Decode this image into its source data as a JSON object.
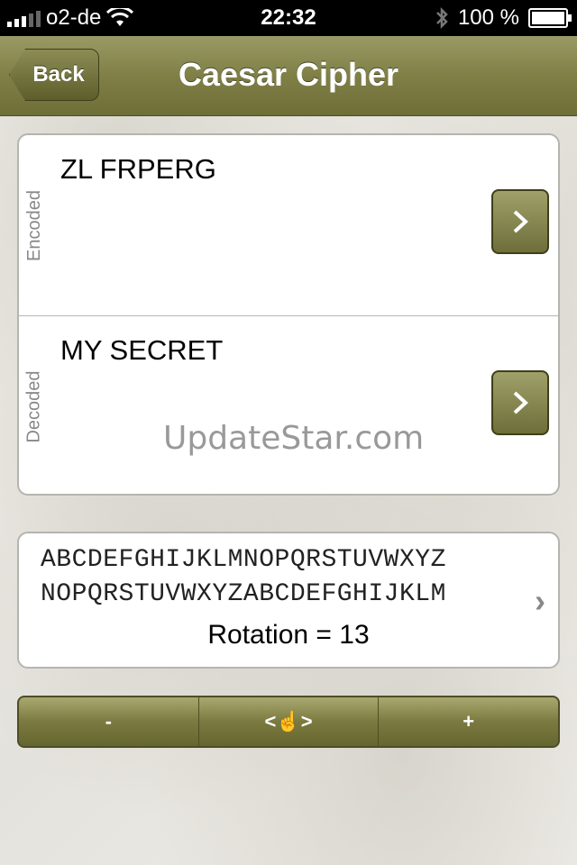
{
  "status": {
    "carrier": "o2-de",
    "time": "22:32",
    "battery": "100 %"
  },
  "nav": {
    "back": "Back",
    "title": "Caesar Cipher"
  },
  "encoded": {
    "label": "Encoded",
    "text": "ZL FRPERG"
  },
  "decoded": {
    "label": "Decoded",
    "text": "MY SECRET"
  },
  "watermark": "UpdateStar.com",
  "rotation_box": {
    "plain": "ABCDEFGHIJKLMNOPQRSTUVWXYZ",
    "cipher": "NOPQRSTUVWXYZABCDEFGHIJKLM",
    "rotation": "Rotation = 13",
    "chevron": "›"
  },
  "controls": {
    "minus": "-",
    "drag": "<☝>",
    "plus": "+"
  },
  "icons": {
    "wifi": "wifi-icon",
    "bluetooth": "bluetooth-icon",
    "battery": "battery-icon",
    "chevron": "chevron-right-icon",
    "hand": "hand-pointer-icon"
  },
  "colors": {
    "accent": "#7f7f46",
    "accent_dark": "#4e4e25"
  }
}
